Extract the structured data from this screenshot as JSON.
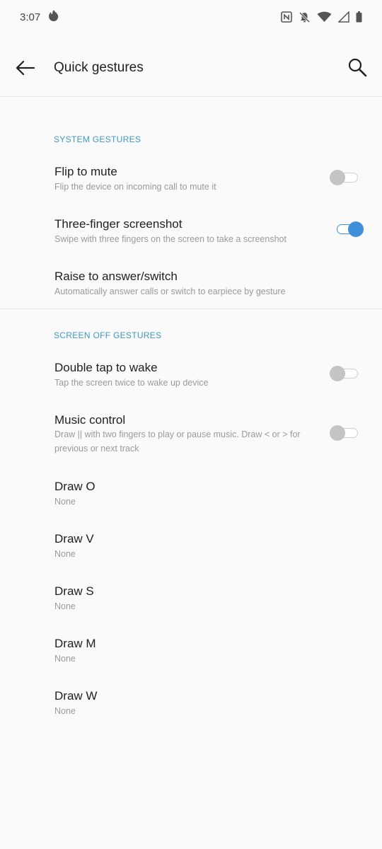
{
  "status_bar": {
    "time": "3:07",
    "left_icons": [
      "notification-flame-icon"
    ],
    "right_icons": [
      "nfc-icon",
      "notifications-off-icon",
      "wifi-icon",
      "cell-signal-icon",
      "battery-icon"
    ]
  },
  "app_bar": {
    "title": "Quick gestures",
    "back_icon": "arrow-left-icon",
    "search_icon": "search-icon"
  },
  "colors": {
    "accent": "#3e98c4",
    "toggle_on": "#3f8fd9",
    "background": "#fafafa"
  },
  "system_gestures": {
    "header": "SYSTEM GESTURES",
    "items": [
      {
        "title": "Flip to mute",
        "subtitle": "Flip the device on incoming call to mute it",
        "toggle": "off"
      },
      {
        "title": "Three-finger screenshot",
        "subtitle": "Swipe with three fingers on the screen to take a screenshot",
        "toggle": "on"
      },
      {
        "title": "Raise to answer/switch",
        "subtitle": "Automatically answer calls or switch to earpiece by gesture"
      }
    ]
  },
  "screen_off_gestures": {
    "header": "SCREEN OFF GESTURES",
    "items": [
      {
        "title": "Double tap to wake",
        "subtitle": "Tap the screen twice to wake up device",
        "toggle": "off"
      },
      {
        "title": "Music control",
        "subtitle": "Draw || with two fingers to play or pause music. Draw < or > for previous or next track",
        "toggle": "off"
      },
      {
        "title": "Draw O",
        "subtitle": "None"
      },
      {
        "title": "Draw V",
        "subtitle": "None"
      },
      {
        "title": "Draw S",
        "subtitle": "None"
      },
      {
        "title": "Draw M",
        "subtitle": "None"
      },
      {
        "title": "Draw W",
        "subtitle": "None"
      }
    ]
  }
}
